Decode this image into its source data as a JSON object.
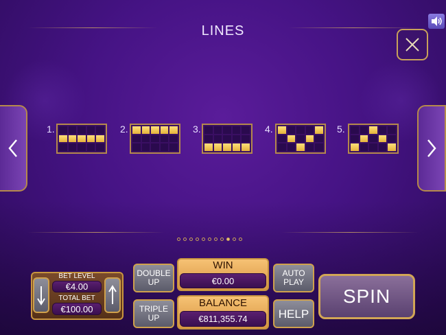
{
  "header": {
    "title": "LINES"
  },
  "controls": {
    "close_icon": "close-icon",
    "sound_icon": "speaker-icon"
  },
  "nav": {
    "prev_icon": "chevron-left-icon",
    "next_icon": "chevron-right-icon"
  },
  "lines": [
    {
      "label": "1.",
      "pattern": [
        [
          0,
          0,
          0,
          0,
          0
        ],
        [
          1,
          1,
          1,
          1,
          1
        ],
        [
          0,
          0,
          0,
          0,
          0
        ]
      ]
    },
    {
      "label": "2.",
      "pattern": [
        [
          1,
          1,
          1,
          1,
          1
        ],
        [
          0,
          0,
          0,
          0,
          0
        ],
        [
          0,
          0,
          0,
          0,
          0
        ]
      ]
    },
    {
      "label": "3.",
      "pattern": [
        [
          0,
          0,
          0,
          0,
          0
        ],
        [
          0,
          0,
          0,
          0,
          0
        ],
        [
          1,
          1,
          1,
          1,
          1
        ]
      ]
    },
    {
      "label": "4.",
      "pattern": [
        [
          1,
          0,
          0,
          0,
          1
        ],
        [
          0,
          1,
          0,
          1,
          0
        ],
        [
          0,
          0,
          1,
          0,
          0
        ]
      ]
    },
    {
      "label": "5.",
      "pattern": [
        [
          0,
          0,
          1,
          0,
          0
        ],
        [
          0,
          1,
          0,
          1,
          0
        ],
        [
          1,
          0,
          0,
          0,
          1
        ]
      ]
    }
  ],
  "pagination": {
    "count": 11,
    "active_index": 8
  },
  "bet": {
    "bet_level_label": "BET LEVEL",
    "bet_level_value": "€4.00",
    "total_bet_label": "TOTAL BET",
    "total_bet_value": "€100.00"
  },
  "buttons": {
    "double_up": "DOUBLE UP",
    "triple_up": "TRIPLE UP",
    "auto_play": "AUTO PLAY",
    "help": "HELP",
    "spin": "SPIN"
  },
  "win": {
    "label": "WIN",
    "value": "€0.00"
  },
  "balance": {
    "label": "BALANCE",
    "value": "€811,355.74"
  },
  "colors": {
    "accent_gold": "#c8953f",
    "background_purple": "#451384",
    "highlight_yellow": "#ffe07a"
  }
}
